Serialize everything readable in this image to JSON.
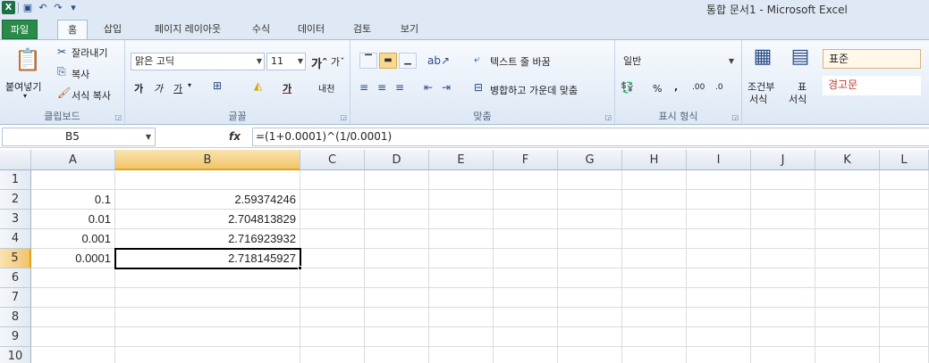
{
  "titlebar": {
    "title": "통합 문서1 - Microsoft Excel",
    "qat_icons": [
      "excel-icon",
      "save-icon",
      "undo-icon",
      "redo-icon",
      "customize-icon"
    ]
  },
  "tabs": {
    "file": "파일",
    "items": [
      "홈",
      "삽입",
      "페이지 레이아웃",
      "수식",
      "데이터",
      "검토",
      "보기"
    ]
  },
  "ribbon": {
    "clipboard": {
      "label": "클립보드",
      "paste": "붙여넣기",
      "cut": "잘라내기",
      "copy": "복사",
      "format_painter": "서식 복사"
    },
    "font": {
      "label": "글꼴",
      "font_name": "맑은 고딕",
      "font_size": "11",
      "bold": "가",
      "italic": "가",
      "underline": "가",
      "phonetic": "내천"
    },
    "alignment": {
      "label": "맞춤",
      "wrap_text": "텍스트 줄 바꿈",
      "merge_center": "병합하고 가운데 맞춤"
    },
    "number": {
      "label": "표시 형식",
      "format": "일반",
      "percent": "%",
      "comma": ",",
      "inc_decimal": ".00",
      "dec_decimal": ".0"
    },
    "styles": {
      "conditional": "조건부",
      "conditional2": "서식",
      "table": "표",
      "table2": "서식",
      "normal": "표준",
      "warning": "경고문"
    }
  },
  "formula_bar": {
    "name_box": "B5",
    "fx": "fx",
    "formula": "=(1+0.0001)^(1/0.0001)"
  },
  "sheet": {
    "columns": [
      "A",
      "B",
      "C",
      "D",
      "E",
      "F",
      "G",
      "H",
      "I",
      "J",
      "K",
      "L"
    ],
    "rows": [
      "1",
      "2",
      "3",
      "4",
      "5",
      "6",
      "7",
      "8",
      "9",
      "10"
    ],
    "data": {
      "A2": "0.1",
      "B2": "2.59374246",
      "A3": "0.01",
      "B3": "2.704813829",
      "A4": "0.001",
      "B4": "2.716923932",
      "A5": "0.0001",
      "B5": "2.718145927"
    },
    "active_cell": "B5"
  }
}
